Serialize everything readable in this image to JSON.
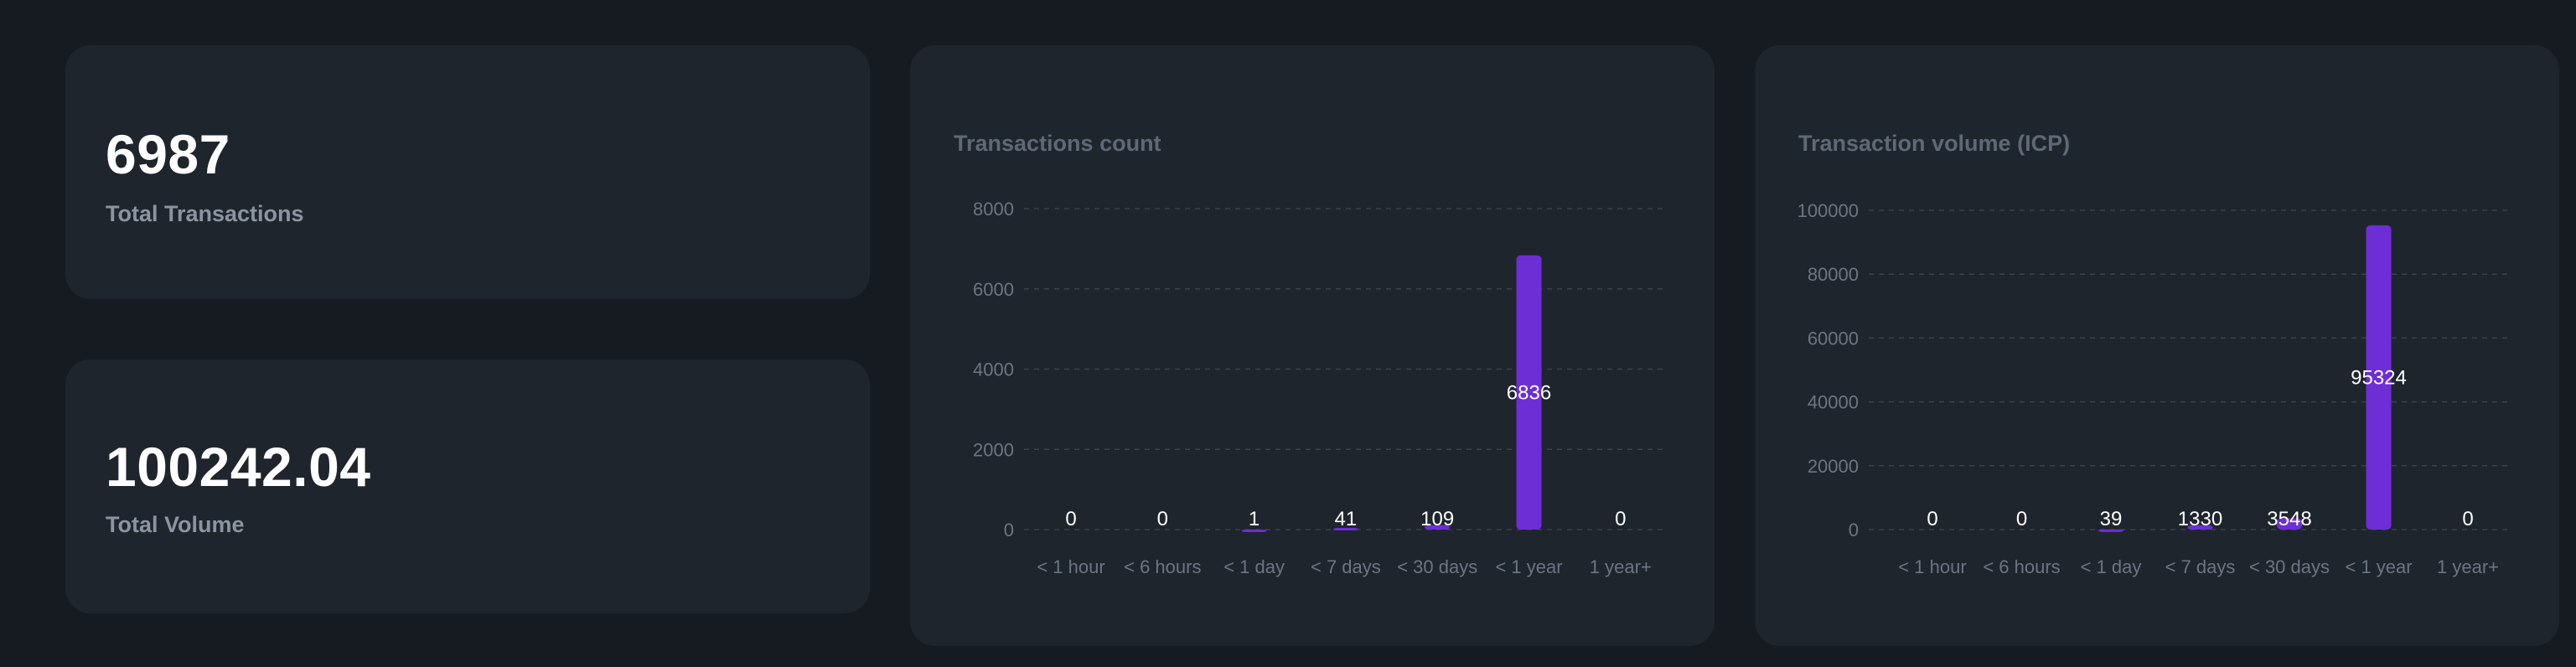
{
  "stats": {
    "total_transactions": {
      "value": "6987",
      "label": "Total Transactions"
    },
    "total_volume": {
      "value": "100242.04",
      "label": "Total Volume"
    }
  },
  "colors": {
    "background": "#161b21",
    "card": "#1f252d",
    "bar": "#6d2ed6",
    "grid": "#3a424d",
    "axis_text": "#6b7582",
    "value_text": "#ffffff"
  },
  "chart_data": [
    {
      "type": "bar",
      "title": "Transactions count",
      "categories": [
        "< 1 hour",
        "< 6 hours",
        "< 1 day",
        "< 7 days",
        "< 30 days",
        "< 1 year",
        "1 year+"
      ],
      "values": [
        0,
        0,
        1,
        41,
        109,
        6836,
        0
      ],
      "value_labels": [
        "0",
        "0",
        "1",
        "41",
        "109",
        "6836",
        "0"
      ],
      "yticks": [
        "0",
        "2000",
        "4000",
        "6000",
        "8000"
      ],
      "ylim": [
        0,
        8000
      ],
      "grid": true,
      "legend": "none"
    },
    {
      "type": "bar",
      "title": "Transaction volume (ICP)",
      "categories": [
        "< 1 hour",
        "< 6 hours",
        "< 1 day",
        "< 7 days",
        "< 30 days",
        "< 1 year",
        "1 year+"
      ],
      "values": [
        0,
        0,
        39,
        1330,
        3548,
        95324,
        0
      ],
      "value_labels": [
        "0",
        "0",
        "39",
        "1330",
        "3548",
        "95324",
        "0"
      ],
      "yticks": [
        "0",
        "20000",
        "40000",
        "60000",
        "80000",
        "100000"
      ],
      "ylim": [
        0,
        100000
      ],
      "grid": true,
      "legend": "none"
    }
  ]
}
